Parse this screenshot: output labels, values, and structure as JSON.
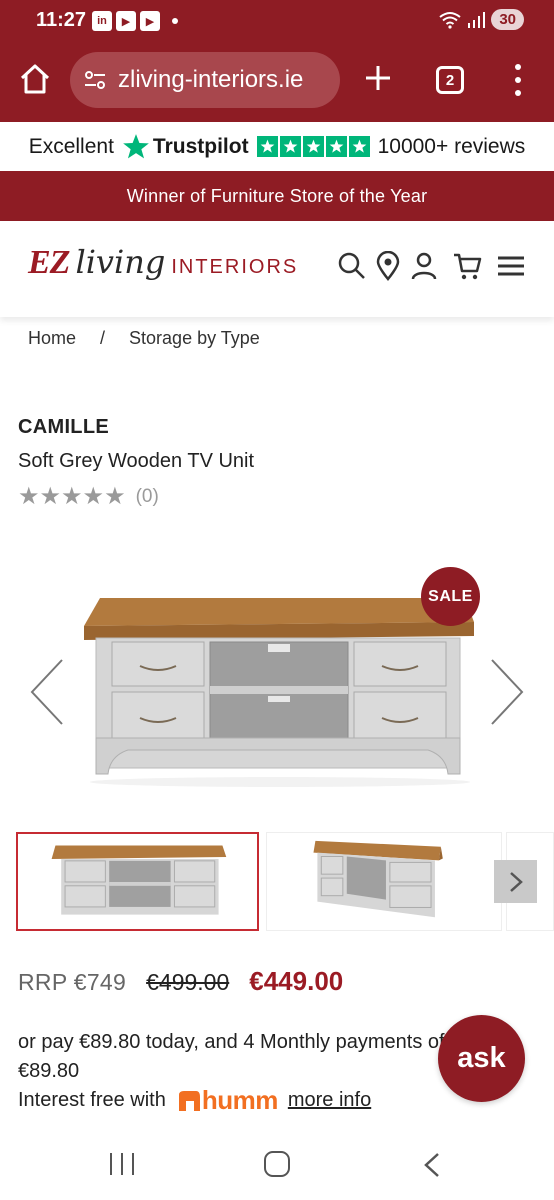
{
  "status_bar": {
    "time": "11:27",
    "battery": "30",
    "app_icons": [
      "linkedin-icon",
      "youtube-icon",
      "youtube-icon"
    ]
  },
  "browser": {
    "url": "zliving-interiors.ie",
    "tab_count": "2"
  },
  "trustpilot": {
    "rating_word": "Excellent",
    "brand": "Trustpilot",
    "reviews": "10000+ reviews"
  },
  "banner": {
    "text": "Winner of Furniture Store of the Year"
  },
  "site_header": {
    "logo_ez": "EZ",
    "logo_living": "living",
    "logo_interiors": "INTERIORS"
  },
  "breadcrumb": {
    "home": "Home",
    "separator": "/",
    "current": "Storage by Type"
  },
  "product": {
    "brand": "CAMILLE",
    "name": "Soft Grey Wooden TV Unit",
    "review_count": "(0)",
    "stars": "★★★★★",
    "sale_badge": "SALE"
  },
  "prices": {
    "rrp": "RRP €749",
    "was": "€499.00",
    "now": "€449.00"
  },
  "finance": {
    "line1": "or pay €89.80 today, and 4 Monthly payments of",
    "line2": "€89.80",
    "interest_free": "Interest free with",
    "humm_logo": "humm",
    "more_info": "more info"
  },
  "chat": {
    "ask_label": "ask"
  },
  "colors": {
    "brand_red": "#8e1c24",
    "trustpilot_green": "#00b67a",
    "humm_orange": "#f26f21"
  }
}
